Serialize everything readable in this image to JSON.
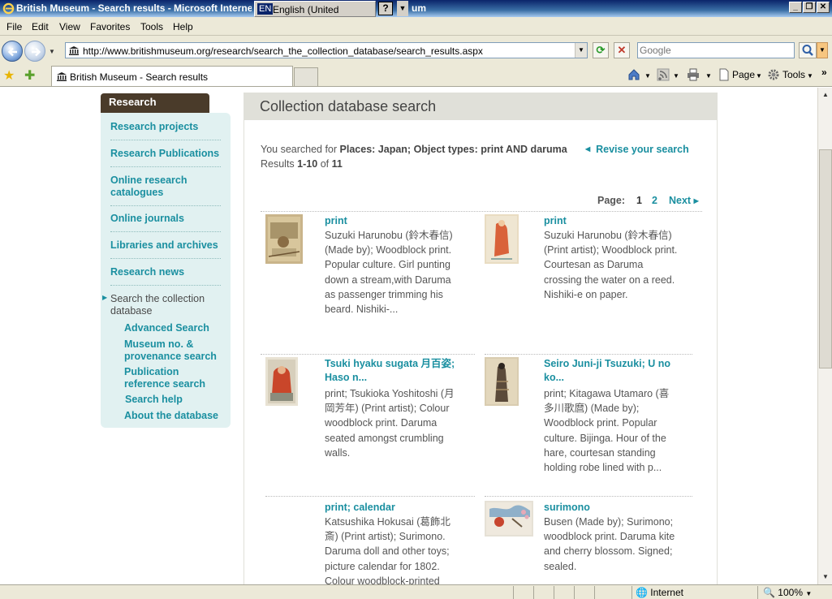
{
  "window": {
    "title": "British Museum - Search results - Microsoft Interne",
    "title_tail": "um",
    "language_code": "EN",
    "language": "English (United Kingdom)",
    "help": "?"
  },
  "menu": [
    "File",
    "Edit",
    "View",
    "Favorites",
    "Tools",
    "Help"
  ],
  "address": {
    "url": "http://www.britishmuseum.org/research/search_the_collection_database/search_results.aspx",
    "search_placeholder": "Google"
  },
  "tab": {
    "label": "British Museum - Search results"
  },
  "commands": {
    "page": "Page",
    "tools": "Tools"
  },
  "sidebar": {
    "heading": "Research",
    "items": [
      "Research projects",
      "Research Publications",
      "Online research catalogues",
      "Online journals",
      "Libraries and archives",
      "Research news"
    ],
    "current": "Search the collection database",
    "subitems": [
      "Advanced Search",
      "Museum no. & provenance search",
      "Publication reference search",
      "Search help",
      "About the database"
    ]
  },
  "main": {
    "heading": "Collection database search",
    "searched_prefix": "You searched for",
    "searched_query": "Places: Japan; Object types: print AND daruma",
    "results_prefix": "Results",
    "results_range": "1-10",
    "results_of": "of",
    "results_total": "11",
    "revise": "Revise your search",
    "pager": {
      "label": "Page:",
      "current": "1",
      "page2": "2",
      "next": "Next"
    },
    "results": [
      {
        "title": "print",
        "description": "Suzuki Harunobu (鈴木春信) (Made by); Woodblock print. Popular culture. Girl punting down a stream,with Daruma as passenger trimming his beard. Nishiki-..."
      },
      {
        "title": "print",
        "description": "Suzuki Harunobu (鈴木春信) (Print artist); Woodblock print. Courtesan as Daruma crossing the water on a reed. Nishiki-e on paper."
      },
      {
        "title": "Tsuki hyaku sugata 月百姿; Haso n...",
        "description": "print; Tsukioka Yoshitoshi (月岡芳年) (Print artist); Colour woodblock print. Daruma seated amongst crumbling walls."
      },
      {
        "title": "Seiro Juni-ji Tsuzuki; U no ko...",
        "description": "print; Kitagawa Utamaro (喜多川歌麿) (Made by); Woodblock print. Popular culture. Bijinga. Hour of the hare, courtesan standing holding robe lined with p..."
      },
      {
        "title": "print; calendar",
        "description": "Katsushika Hokusai (葛飾北斎) (Print artist); Surimono. Daruma doll and other toys; picture calendar for 1802. Colour woodblock-printed"
      },
      {
        "title": "surimono",
        "description": "Busen (Made by); Surimono; woodblock print. Daruma kite and cherry blossom. Signed; sealed."
      }
    ]
  },
  "status": {
    "zone": "Internet",
    "zoom": "100%"
  },
  "colors": {
    "accent": "#1a8fa0",
    "sidebar_bg": "#e1f1f1",
    "sidebar_head": "#4a3b2a",
    "header_bg": "#e0e0d9"
  }
}
